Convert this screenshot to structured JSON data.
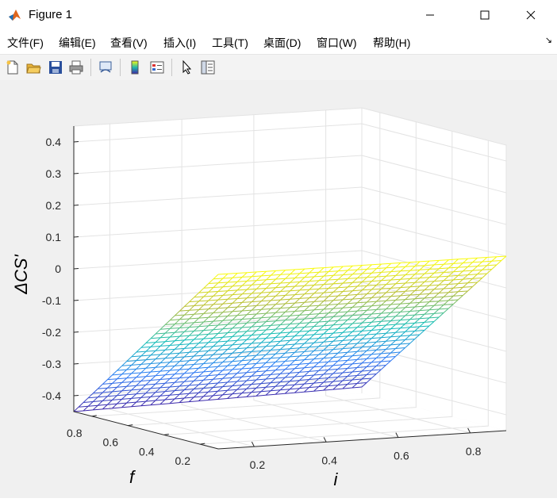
{
  "window": {
    "title": "Figure 1",
    "app_icon": "matlab-icon",
    "controls": [
      "minimize-icon",
      "maximize-icon",
      "close-icon"
    ]
  },
  "menu": [
    {
      "label": "文件(F)",
      "key": "F"
    },
    {
      "label": "编辑(E)",
      "key": "E"
    },
    {
      "label": "查看(V)",
      "key": "V"
    },
    {
      "label": "插入(I)",
      "key": "I"
    },
    {
      "label": "工具(T)",
      "key": "T"
    },
    {
      "label": "桌面(D)",
      "key": "D"
    },
    {
      "label": "窗口(W)",
      "key": "W"
    },
    {
      "label": "帮助(H)",
      "key": "H"
    }
  ],
  "menu_dock_icon": "dock-arrow-icon",
  "toolbar": [
    "new-figure-icon",
    "open-file-icon",
    "save-icon",
    "print-icon",
    "link-plot-icon",
    "colorbar-icon",
    "legend-icon",
    "pointer-icon",
    "property-inspector-icon"
  ],
  "colors": {
    "canvas": "#f0f0f0",
    "axes_bg": "#ffffff",
    "grid": "#e0e0e0",
    "colormap": "parula"
  },
  "chart_data": {
    "type": "surface",
    "title": "",
    "xlabel": "i",
    "ylabel": "f",
    "zlabel": "ΔCS'",
    "xlim": [
      0.1,
      0.9
    ],
    "ylim": [
      0.1,
      0.9
    ],
    "zlim": [
      -0.45,
      0.45
    ],
    "xticks": [
      "0.2",
      "0.4",
      "0.6",
      "0.8"
    ],
    "yticks": [
      "0.2",
      "0.4",
      "0.6",
      "0.8"
    ],
    "zticks": [
      "-0.4",
      "-0.3",
      "-0.2",
      "-0.1",
      "0",
      "0.1",
      "0.2",
      "0.3",
      "0.4"
    ],
    "grid": true,
    "mesh": "wireframe",
    "x_range": [
      0.1,
      0.9
    ],
    "y_range": [
      0.1,
      0.9
    ],
    "grid_lines": 31,
    "surface_z": {
      "at_i_0.1_f_0.1": 0.1,
      "at_i_0.9_f_0.1": 0.1,
      "at_i_0.1_f_0.9": -0.45,
      "at_i_0.9_f_0.9": -0.43
    },
    "formula_description": "planar surface: z decreases linearly with f, nearly constant in i"
  }
}
